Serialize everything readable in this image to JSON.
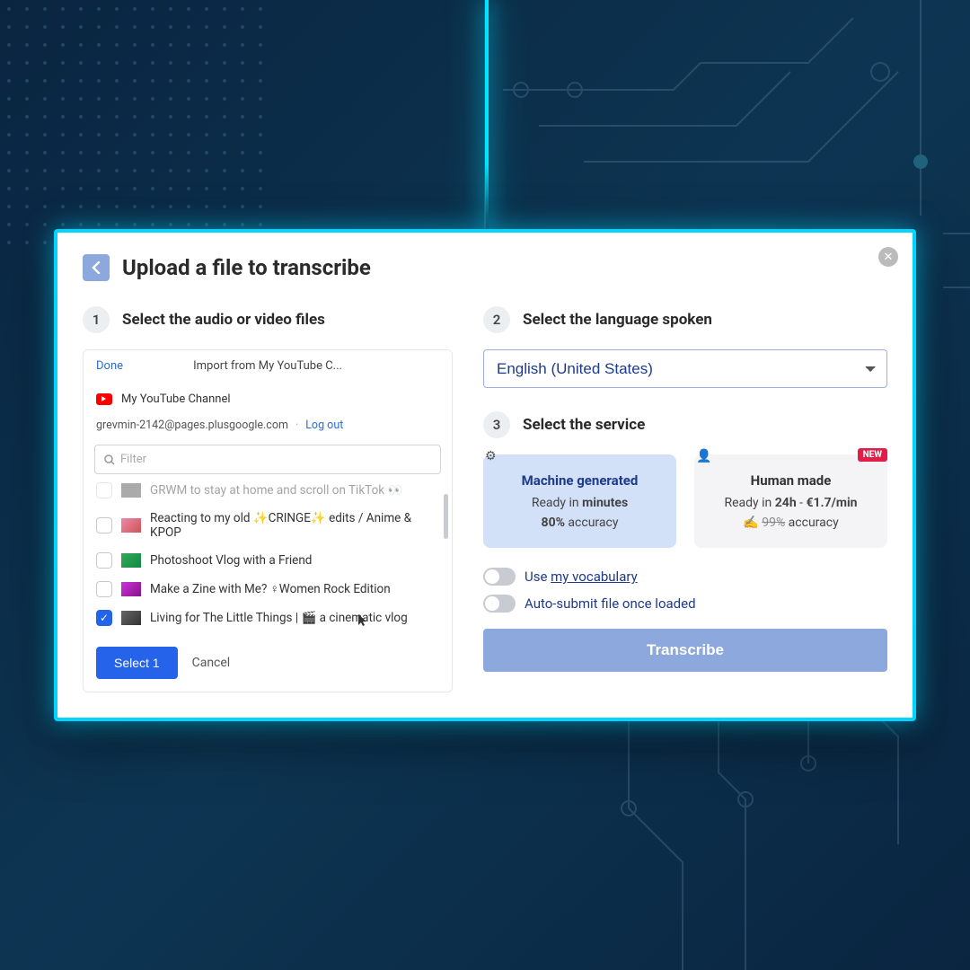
{
  "modal": {
    "title": "Upload a file to transcribe"
  },
  "step1": {
    "num": "1",
    "label": "Select the audio or video files",
    "done": "Done",
    "import_title": "Import from My YouTube C...",
    "channel": "My YouTube Channel",
    "account": "grevmin-2142@pages.plusgoogle.com",
    "logout": "Log out",
    "filter_placeholder": "Filter",
    "videos": [
      {
        "title": "GRWM to stay at home and scroll on TikTok 👀",
        "checked": false
      },
      {
        "title": "Reacting to my old ✨CRINGE✨ edits / Anime & KPOP",
        "checked": false
      },
      {
        "title": "Photoshoot Vlog with a Friend",
        "checked": false
      },
      {
        "title": "Make a Zine with Me? ♀Women Rock Edition",
        "checked": false
      },
      {
        "title": "Living for The Little Things | 🎬 a cinematic vlog",
        "checked": true
      }
    ],
    "select_btn": "Select 1",
    "cancel": "Cancel"
  },
  "step2": {
    "num": "2",
    "label": "Select the language spoken",
    "language": "English (United States)"
  },
  "step3": {
    "num": "3",
    "label": "Select the service",
    "machine": {
      "title": "Machine generated",
      "ready_prefix": "Ready in ",
      "ready_bold": "minutes",
      "acc_bold": "80%",
      "acc_suffix": " accuracy"
    },
    "human": {
      "title": "Human made",
      "ready_prefix": "Ready in ",
      "ready_time": "24h",
      "ready_sep": " - ",
      "ready_price": "€1.7/min",
      "hand_emoji": "✍️ ",
      "acc_strike": "99%",
      "acc_suffix": " accuracy",
      "new_badge": "NEW"
    },
    "vocab_prefix": "Use ",
    "vocab_link": "my vocabulary",
    "autosubmit": "Auto-submit file once loaded",
    "transcribe": "Transcribe"
  }
}
